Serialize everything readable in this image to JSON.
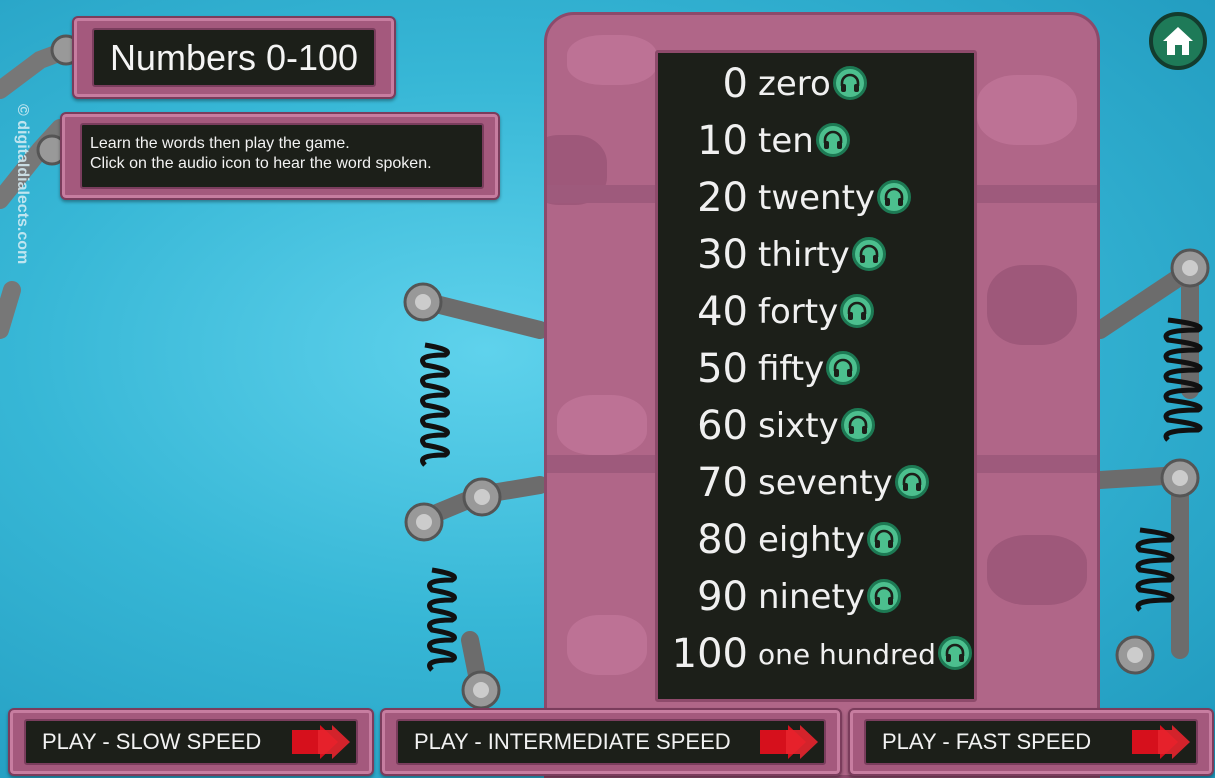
{
  "title": "Numbers 0-100",
  "instructions": {
    "line1": "Learn the words then play the game.",
    "line2": "Click on the audio icon to hear the word spoken."
  },
  "watermark": "© digitaldialects.com",
  "numbers": [
    {
      "num": "0",
      "word": "zero"
    },
    {
      "num": "10",
      "word": "ten"
    },
    {
      "num": "20",
      "word": "twenty"
    },
    {
      "num": "30",
      "word": "thirty"
    },
    {
      "num": "40",
      "word": "forty"
    },
    {
      "num": "50",
      "word": "fifty"
    },
    {
      "num": "60",
      "word": "sixty"
    },
    {
      "num": "70",
      "word": "seventy"
    },
    {
      "num": "80",
      "word": "eighty"
    },
    {
      "num": "90",
      "word": "ninety"
    },
    {
      "num": "100",
      "word": "one hundred"
    }
  ],
  "buttons": {
    "slow": "PLAY  - SLOW SPEED",
    "intermediate": "PLAY  - INTERMEDIATE SPEED",
    "fast": "PLAY  - FAST SPEED"
  },
  "icons": {
    "home": "home-icon",
    "audio": "headphones-icon",
    "play": "double-arrow-icon"
  },
  "colors": {
    "background": "#37b7d6",
    "panel_pink": "#a4597d",
    "board": "#1c1f19",
    "audio_green": "#4cbf8e",
    "arrow_red": "#d6101c"
  }
}
